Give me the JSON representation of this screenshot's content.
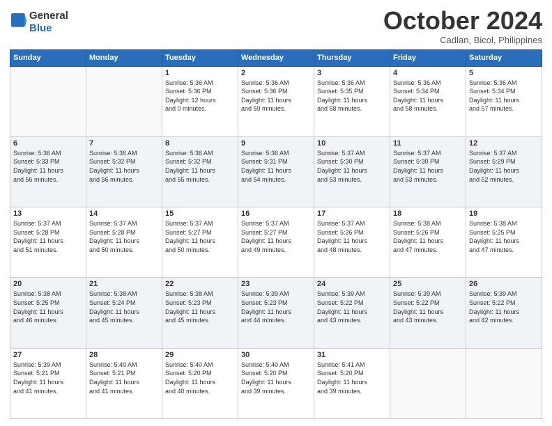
{
  "logo": {
    "line1": "General",
    "line2": "Blue"
  },
  "title": "October 2024",
  "subtitle": "Cadlan, Bicol, Philippines",
  "weekdays": [
    "Sunday",
    "Monday",
    "Tuesday",
    "Wednesday",
    "Thursday",
    "Friday",
    "Saturday"
  ],
  "weeks": [
    [
      {
        "day": "",
        "info": ""
      },
      {
        "day": "",
        "info": ""
      },
      {
        "day": "1",
        "info": "Sunrise: 5:36 AM\nSunset: 5:36 PM\nDaylight: 12 hours\nand 0 minutes."
      },
      {
        "day": "2",
        "info": "Sunrise: 5:36 AM\nSunset: 5:36 PM\nDaylight: 11 hours\nand 59 minutes."
      },
      {
        "day": "3",
        "info": "Sunrise: 5:36 AM\nSunset: 5:35 PM\nDaylight: 11 hours\nand 58 minutes."
      },
      {
        "day": "4",
        "info": "Sunrise: 5:36 AM\nSunset: 5:34 PM\nDaylight: 11 hours\nand 58 minutes."
      },
      {
        "day": "5",
        "info": "Sunrise: 5:36 AM\nSunset: 5:34 PM\nDaylight: 11 hours\nand 57 minutes."
      }
    ],
    [
      {
        "day": "6",
        "info": "Sunrise: 5:36 AM\nSunset: 5:33 PM\nDaylight: 11 hours\nand 56 minutes."
      },
      {
        "day": "7",
        "info": "Sunrise: 5:36 AM\nSunset: 5:32 PM\nDaylight: 11 hours\nand 56 minutes."
      },
      {
        "day": "8",
        "info": "Sunrise: 5:36 AM\nSunset: 5:32 PM\nDaylight: 11 hours\nand 55 minutes."
      },
      {
        "day": "9",
        "info": "Sunrise: 5:36 AM\nSunset: 5:31 PM\nDaylight: 11 hours\nand 54 minutes."
      },
      {
        "day": "10",
        "info": "Sunrise: 5:37 AM\nSunset: 5:30 PM\nDaylight: 11 hours\nand 53 minutes."
      },
      {
        "day": "11",
        "info": "Sunrise: 5:37 AM\nSunset: 5:30 PM\nDaylight: 11 hours\nand 53 minutes."
      },
      {
        "day": "12",
        "info": "Sunrise: 5:37 AM\nSunset: 5:29 PM\nDaylight: 11 hours\nand 52 minutes."
      }
    ],
    [
      {
        "day": "13",
        "info": "Sunrise: 5:37 AM\nSunset: 5:28 PM\nDaylight: 11 hours\nand 51 minutes."
      },
      {
        "day": "14",
        "info": "Sunrise: 5:37 AM\nSunset: 5:28 PM\nDaylight: 11 hours\nand 50 minutes."
      },
      {
        "day": "15",
        "info": "Sunrise: 5:37 AM\nSunset: 5:27 PM\nDaylight: 11 hours\nand 50 minutes."
      },
      {
        "day": "16",
        "info": "Sunrise: 5:37 AM\nSunset: 5:27 PM\nDaylight: 11 hours\nand 49 minutes."
      },
      {
        "day": "17",
        "info": "Sunrise: 5:37 AM\nSunset: 5:26 PM\nDaylight: 11 hours\nand 48 minutes."
      },
      {
        "day": "18",
        "info": "Sunrise: 5:38 AM\nSunset: 5:26 PM\nDaylight: 11 hours\nand 47 minutes."
      },
      {
        "day": "19",
        "info": "Sunrise: 5:38 AM\nSunset: 5:25 PM\nDaylight: 11 hours\nand 47 minutes."
      }
    ],
    [
      {
        "day": "20",
        "info": "Sunrise: 5:38 AM\nSunset: 5:25 PM\nDaylight: 11 hours\nand 46 minutes."
      },
      {
        "day": "21",
        "info": "Sunrise: 5:38 AM\nSunset: 5:24 PM\nDaylight: 11 hours\nand 45 minutes."
      },
      {
        "day": "22",
        "info": "Sunrise: 5:38 AM\nSunset: 5:23 PM\nDaylight: 11 hours\nand 45 minutes."
      },
      {
        "day": "23",
        "info": "Sunrise: 5:39 AM\nSunset: 5:23 PM\nDaylight: 11 hours\nand 44 minutes."
      },
      {
        "day": "24",
        "info": "Sunrise: 5:39 AM\nSunset: 5:22 PM\nDaylight: 11 hours\nand 43 minutes."
      },
      {
        "day": "25",
        "info": "Sunrise: 5:39 AM\nSunset: 5:22 PM\nDaylight: 11 hours\nand 43 minutes."
      },
      {
        "day": "26",
        "info": "Sunrise: 5:39 AM\nSunset: 5:22 PM\nDaylight: 11 hours\nand 42 minutes."
      }
    ],
    [
      {
        "day": "27",
        "info": "Sunrise: 5:39 AM\nSunset: 5:21 PM\nDaylight: 11 hours\nand 41 minutes."
      },
      {
        "day": "28",
        "info": "Sunrise: 5:40 AM\nSunset: 5:21 PM\nDaylight: 11 hours\nand 41 minutes."
      },
      {
        "day": "29",
        "info": "Sunrise: 5:40 AM\nSunset: 5:20 PM\nDaylight: 11 hours\nand 40 minutes."
      },
      {
        "day": "30",
        "info": "Sunrise: 5:40 AM\nSunset: 5:20 PM\nDaylight: 11 hours\nand 39 minutes."
      },
      {
        "day": "31",
        "info": "Sunrise: 5:41 AM\nSunset: 5:20 PM\nDaylight: 11 hours\nand 39 minutes."
      },
      {
        "day": "",
        "info": ""
      },
      {
        "day": "",
        "info": ""
      }
    ]
  ]
}
